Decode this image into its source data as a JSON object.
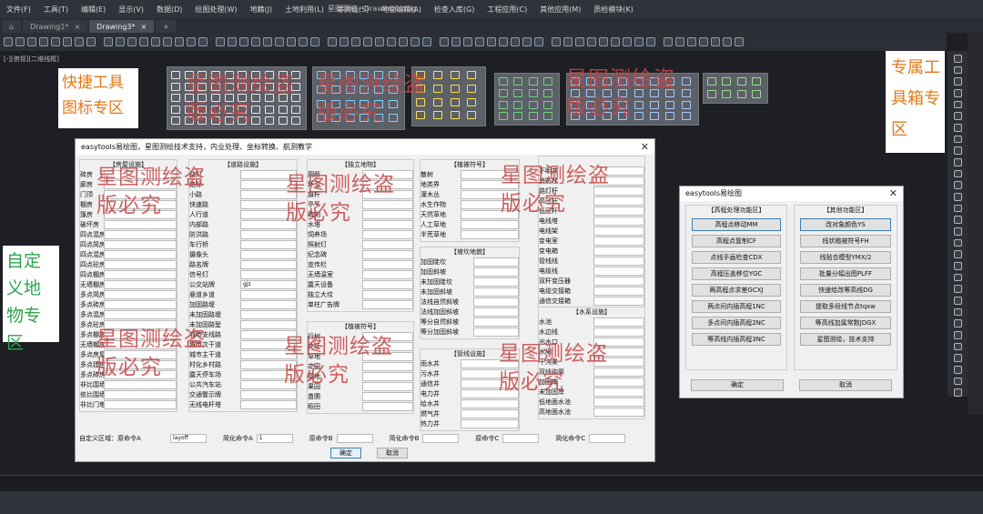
{
  "menu": {
    "items": [
      "文件(F)",
      "工具(T)",
      "编辑(E)",
      "显示(V)",
      "数据(D)",
      "绘图处理(W)",
      "地籍(J)",
      "土地利用(L)",
      "等高线(S)",
      "地物编辑(A)",
      "检查入库(G)",
      "工程应用(C)",
      "其他应用(M)",
      "质检模块(K)"
    ],
    "doc_title": "星图测绘 - Drawing3.dwg"
  },
  "tabs": [
    {
      "label": "Drawing1*"
    },
    {
      "label": "Drawing3*"
    }
  ],
  "view_label": "[-][俯视][二维线框]",
  "callouts": {
    "quick": "快捷工具图标专区",
    "toolbox": "专属工具箱专区",
    "custom": "自定义地物专区"
  },
  "watermark": "星图测绘盗版必究",
  "main_dialog": {
    "title": "easytools易绘图，星图测绘技术支持，内业处理、坐标转换、航测教学",
    "columns": [
      {
        "head": "【房屋设施】",
        "rows": [
          "砖房",
          "廊房",
          "门顶",
          "棚房",
          "篷房",
          "破坏房",
          "四点混房",
          "四点简房",
          "四点混房",
          "四点砼房",
          "四点棚房",
          "无墙棚房",
          "多点简房",
          "多点砖房",
          "多点混房",
          "多点砼房",
          "多点棚房",
          "无墙棚房",
          "多点房屋",
          "多点建房",
          "多点砖房",
          "非比围墙",
          "依比围墙",
          "非比门墩"
        ]
      },
      {
        "head": "【道路设施】",
        "rows": [
          "路灯",
          "路标",
          "小路",
          "快速路",
          "人行道",
          "内部路",
          "防洪路",
          "车行桥",
          "摄像头",
          "路名牌",
          "信号灯",
          "公交站牌",
          "悬道乡道",
          "加固路堤",
          "未加固路堤",
          "未加固路堑",
          "城市支线路",
          "城市次干道",
          "城市主干道",
          "村化乡村路",
          "露天停车场",
          "公共汽车站",
          "交通警示牌",
          "无线电杆塔"
        ]
      },
      {
        "head": "【独立地物】",
        "rows": [
          "厕所",
          "环卫",
          "旗杆",
          "亭子",
          "碑刻",
          "水塔",
          "饲养场",
          "照射灯",
          "纪念碑",
          "宣传栏",
          "无墙温室",
          "露天设备",
          "独立大坟",
          "单柱广告牌"
        ]
      },
      {
        "head": "【植被符号】",
        "rows": [
          "行树",
          "花坛",
          "草地",
          "花园",
          "菜地",
          "果园",
          "苗圃",
          "稻田"
        ]
      },
      {
        "head": "【植被符号】",
        "rows": [
          "散树",
          "地类界",
          "灌木丛",
          "水生作物",
          "天然草地",
          "人工草地",
          "半荒草地"
        ]
      },
      {
        "head": "【坡坎地貌】",
        "rows": [
          "加固陡坎",
          "加固斜坡",
          "未加固陡坎",
          "未加固斜坡",
          "法线自然斜坡",
          "法线加固斜坡",
          "等分自然斜坡",
          "等分加固斜坡"
        ]
      },
      {
        "head": "【管线设施】",
        "rows": [
          "雨水井",
          "污水井",
          "通信井",
          "电力井",
          "给水井",
          "燃气井",
          "热力井"
        ]
      },
      {
        "head": "",
        "rows": [
          "不明井",
          "消防栓",
          "路灯杆",
          "高压杆",
          "低压杆",
          "电线塔",
          "电线架",
          "变电室",
          "变电箱",
          "管线线",
          "电缆线",
          "双杆变压器",
          "电缆交接箱",
          "通信交接箱"
        ]
      },
      {
        "head": "【水系设施】",
        "rows": [
          "水池",
          "水边线",
          "出水口",
          "水闸",
          "干沟渠",
          "双线沟渠",
          "加固岸",
          "未加固岸",
          "低地面水池",
          "高地面水池"
        ]
      }
    ],
    "custom_row": {
      "label": "自定义区域：原命令A",
      "field_a": "layoff",
      "cmd_a": "简化命令A",
      "field_b": "1",
      "cmd_b": "原命令B",
      "cmd_c": "简化命令B",
      "cmd_d": "原命令C",
      "cmd_e": "简化命令C"
    },
    "ok": "确定",
    "cancel": "取消"
  },
  "side_dialog": {
    "title": "easytools易绘图",
    "left_head": "【高程处理功能区】",
    "right_head": "【其他功能区】",
    "left_buttons": [
      "高程点移动MM",
      "高程点复制CF",
      "点线手画检查CDX",
      "高程压盖移位YGC",
      "两高程点求差GCXJ",
      "两点间内插高程1NC",
      "多点间内插高程2NC",
      "等高线内插高程3NC"
    ],
    "right_buttons": [
      "改对象颜色YS",
      "线状植被符号FH",
      "线贴合模型YMX/2",
      "批量分幅出图PLFF",
      "快速绘改等高线DG",
      "提取多段线节点tqxw",
      "等高线加属常数JDGX",
      "星图测绘，技术支持"
    ],
    "ok": "确定",
    "cancel": "取消"
  },
  "colors": {
    "watermark": "#c84646",
    "callout_orange": "#e07a1a",
    "callout_green": "#2ea44f"
  }
}
